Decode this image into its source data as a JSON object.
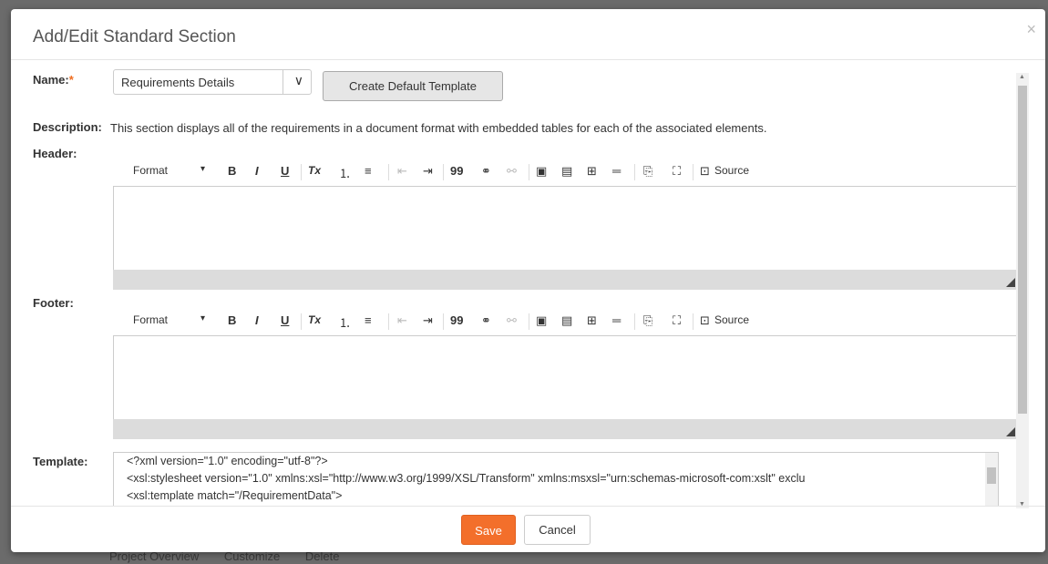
{
  "modal": {
    "title": "Add/Edit Standard Section",
    "close_icon": "×"
  },
  "name": {
    "label": "Name:",
    "required": "*",
    "selected": "Requirements Details",
    "chevron": "∨"
  },
  "create_default_label": "Create Default Template",
  "description": {
    "label": "Description:",
    "text": "This section displays all of the requirements in a document format with embedded tables for each of the associated elements."
  },
  "header": {
    "label": "Header:"
  },
  "footer_section": {
    "label": "Footer:"
  },
  "toolbar": {
    "format": "Format",
    "dropdown": "▾",
    "bold": "B",
    "italic": "I",
    "underline": "U",
    "remove_format": "Tx",
    "numbered_list": "⒈",
    "bulleted_list": "≡",
    "outdent": "⇤",
    "indent": "⇥",
    "blockquote": "99",
    "link": "⚭",
    "unlink": "⚯",
    "image": "▣",
    "flash": "▤",
    "table": "⊞",
    "hr": "═",
    "paste": "⎘",
    "maximize": "⛶",
    "source_icon": "⊡",
    "source": "Source"
  },
  "template": {
    "label": "Template:",
    "lines": [
      "<?xml version=\"1.0\" encoding=\"utf-8\"?>",
      "<xsl:stylesheet version=\"1.0\" xmlns:xsl=\"http://www.w3.org/1999/XSL/Transform\" xmlns:msxsl=\"urn:schemas-microsoft-com:xslt\" exclu",
      "  <xsl:template match=\"/RequirementData\">"
    ]
  },
  "buttons": {
    "save": "Save",
    "cancel": "Cancel"
  },
  "background": {
    "items": [
      "Project Overview",
      "Customize",
      "Delete"
    ]
  },
  "colors": {
    "accent": "#f36f2b",
    "required": "#ef6c1f"
  }
}
